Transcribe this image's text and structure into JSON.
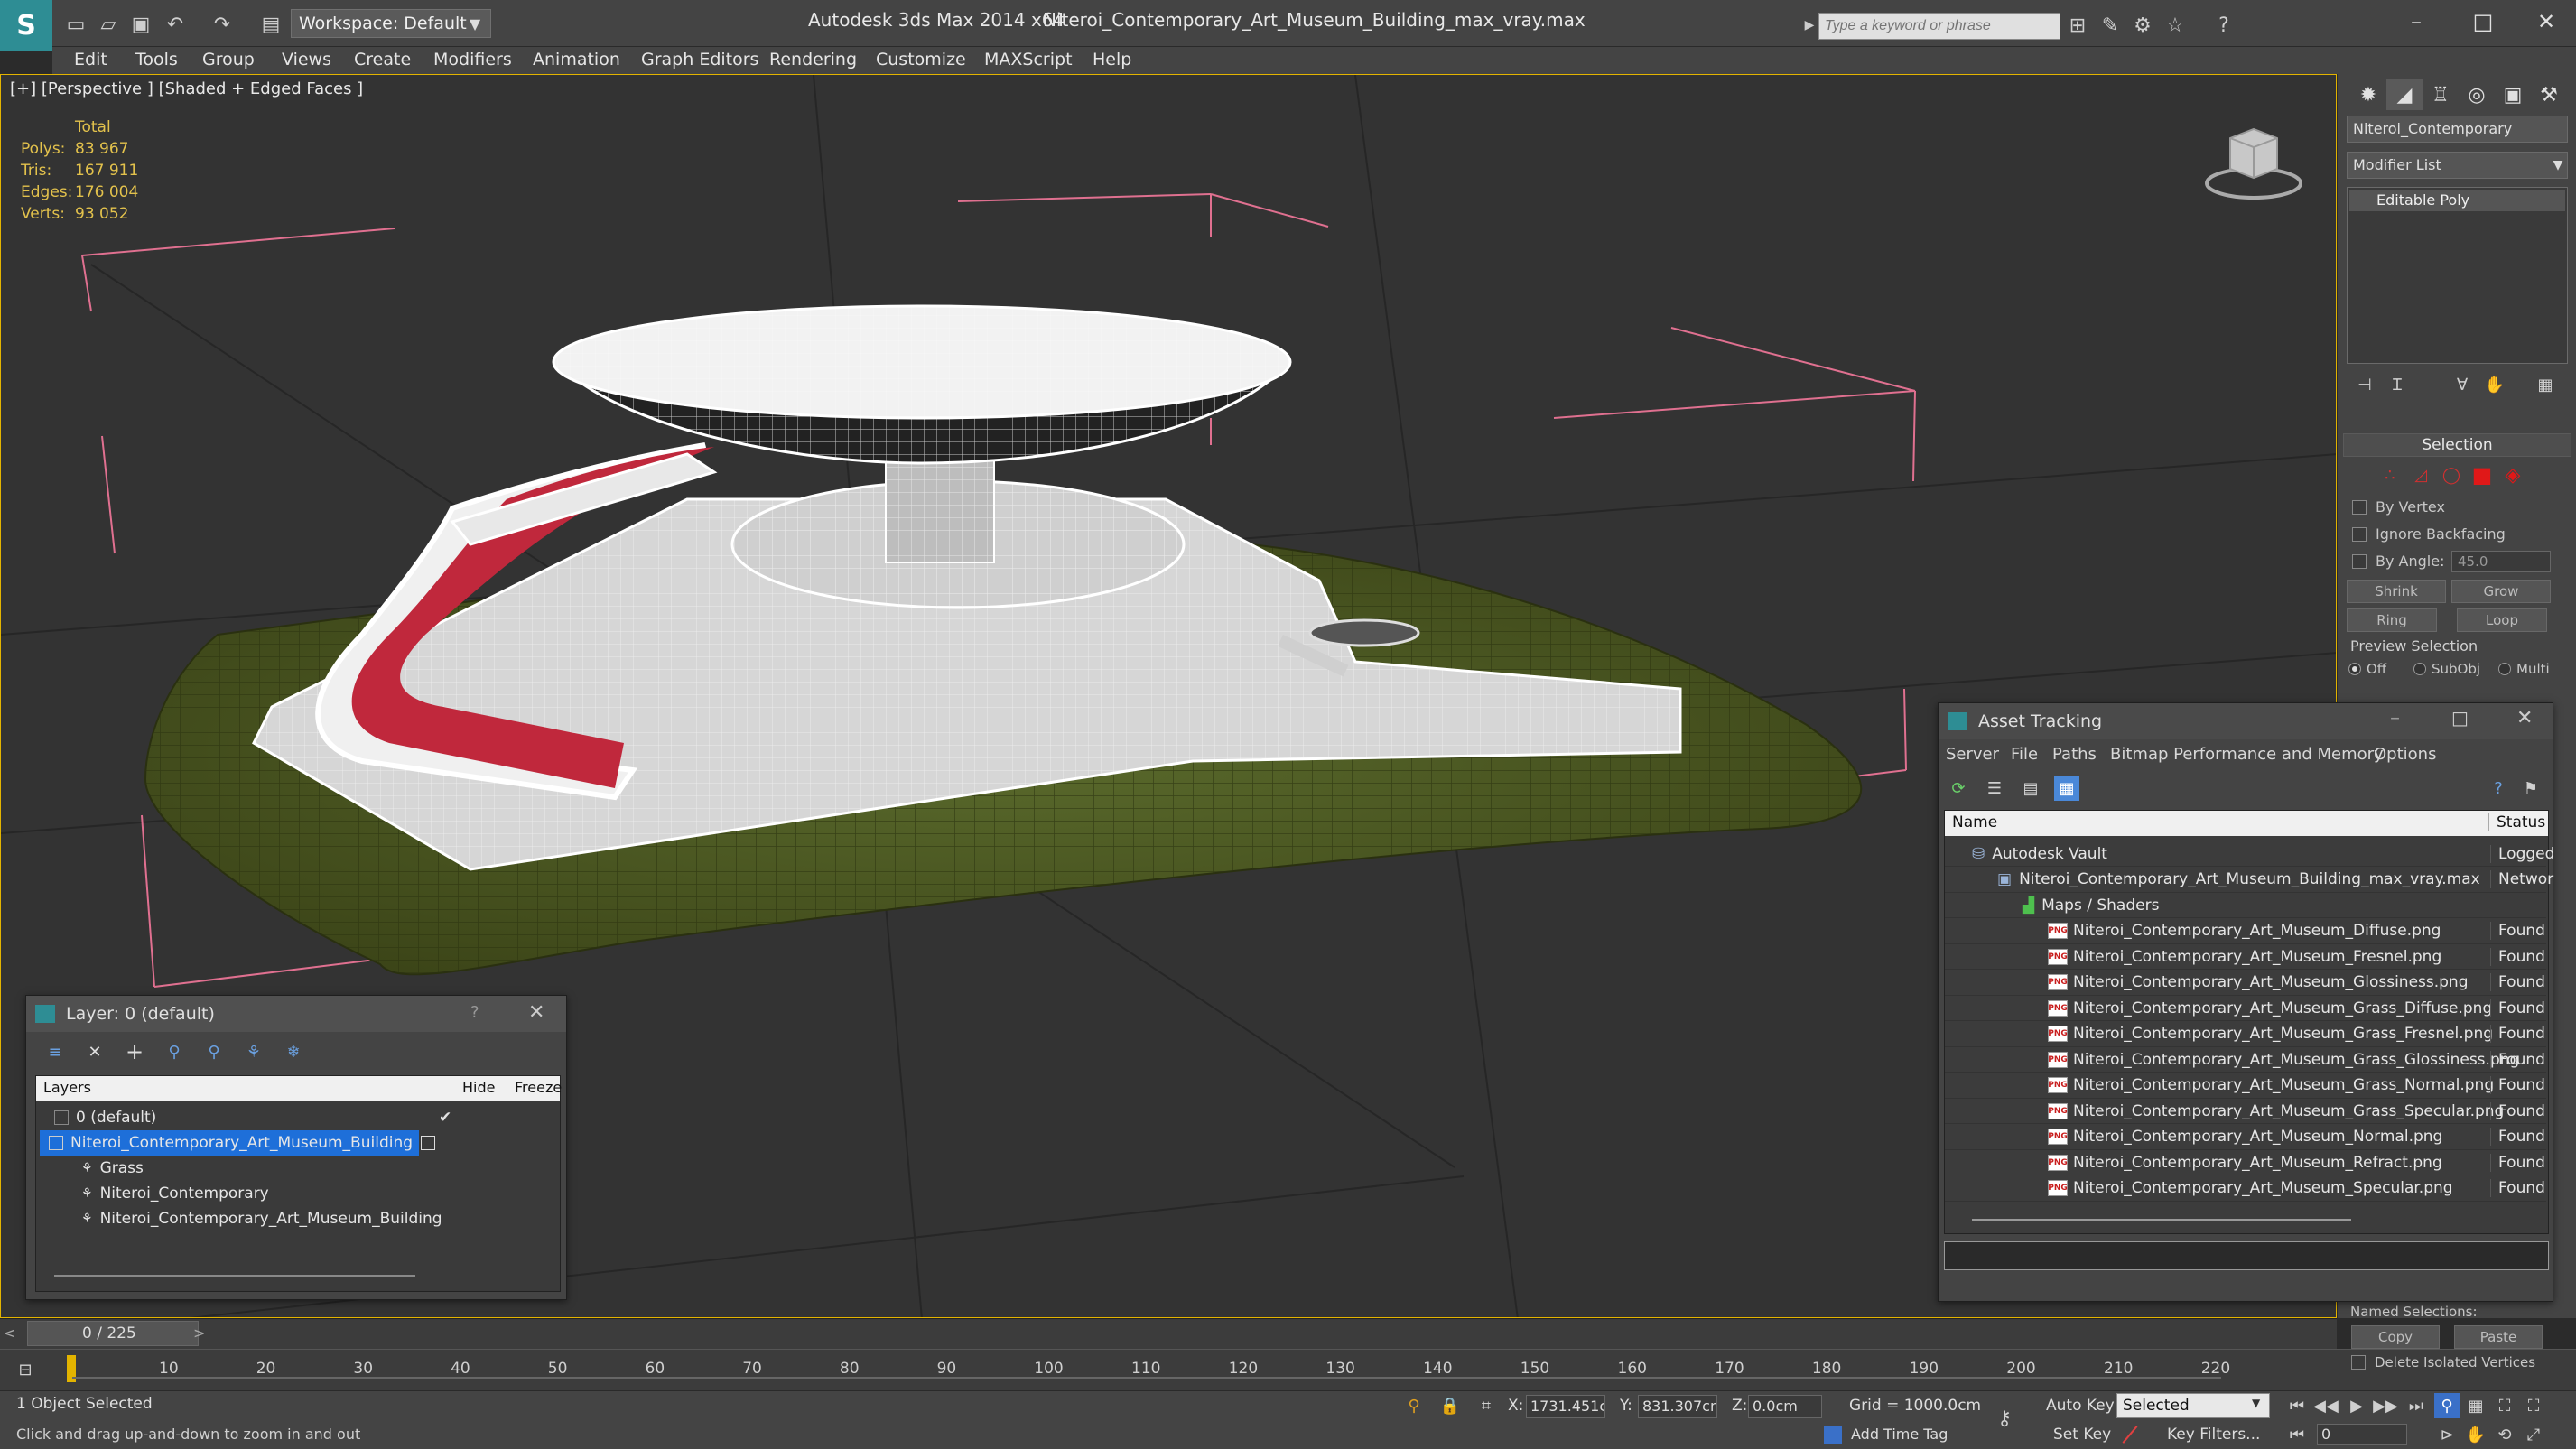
{
  "titlebar": {
    "workspace": "Workspace: Default",
    "app_title": "Autodesk 3ds Max  2014 x64",
    "file_title": "Niteroi_Contemporary_Art_Museum_Building_max_vray.max",
    "search_placeholder": "Type a keyword or phrase"
  },
  "menu": [
    "Edit",
    "Tools",
    "Group",
    "Views",
    "Create",
    "Modifiers",
    "Animation",
    "Graph Editors",
    "Rendering",
    "Customize",
    "MAXScript",
    "Help"
  ],
  "viewport": {
    "label": "[+] [Perspective ] [Shaded + Edged Faces ]",
    "stats": {
      "header": "Total",
      "rows": [
        {
          "label": "Polys:",
          "value": "83 967"
        },
        {
          "label": "Tris:",
          "value": "167 911"
        },
        {
          "label": "Edges:",
          "value": "176 004"
        },
        {
          "label": "Verts:",
          "value": "93 052"
        }
      ]
    }
  },
  "command_panel": {
    "object_name": "Niteroi_Contemporary",
    "modifier_list": "Modifier List",
    "modifier_item": "Editable Poly",
    "selection_title": "Selection",
    "by_vertex": "By Vertex",
    "ignore_backfacing": "Ignore Backfacing",
    "by_angle": "By Angle:",
    "angle_value": "45.0",
    "shrink": "Shrink",
    "grow": "Grow",
    "ring": "Ring",
    "loop": "Loop",
    "preview_selection": "Preview Selection",
    "preview_off": "Off",
    "preview_subobj": "SubObj",
    "preview_multi": "Multi",
    "named_selections": "Named Selections:",
    "copy": "Copy",
    "paste": "Paste",
    "delete_isolated": "Delete Isolated Vertices"
  },
  "layer_window": {
    "title": "Layer: 0 (default)",
    "help": "?",
    "col_layers": "Layers",
    "col_hide": "Hide",
    "col_freeze": "Freeze",
    "rows": [
      {
        "name": "0 (default)",
        "level": 0
      },
      {
        "name": "Niteroi_Contemporary_Art_Museum_Building",
        "level": 0
      },
      {
        "name": "Grass",
        "level": 1
      },
      {
        "name": "Niteroi_Contemporary",
        "level": 1
      },
      {
        "name": "Niteroi_Contemporary_Art_Museum_Building",
        "level": 1
      }
    ]
  },
  "asset_window": {
    "title": "Asset Tracking",
    "menu": [
      "Server",
      "File",
      "Paths",
      "Bitmap Performance and Memory",
      "Options"
    ],
    "col_name": "Name",
    "col_status": "Status",
    "rows": [
      {
        "name": "Autodesk Vault",
        "status": "Logged",
        "level": 0,
        "icon": "vault"
      },
      {
        "name": "Niteroi_Contemporary_Art_Museum_Building_max_vray.max",
        "status": "Networ",
        "level": 1,
        "icon": "max"
      },
      {
        "name": "Maps / Shaders",
        "status": "",
        "level": 2,
        "icon": "maps"
      },
      {
        "name": "Niteroi_Contemporary_Art_Museum_Diffuse.png",
        "status": "Found",
        "level": 3,
        "icon": "png"
      },
      {
        "name": "Niteroi_Contemporary_Art_Museum_Fresnel.png",
        "status": "Found",
        "level": 3,
        "icon": "png"
      },
      {
        "name": "Niteroi_Contemporary_Art_Museum_Glossiness.png",
        "status": "Found",
        "level": 3,
        "icon": "png"
      },
      {
        "name": "Niteroi_Contemporary_Art_Museum_Grass_Diffuse.png",
        "status": "Found",
        "level": 3,
        "icon": "png"
      },
      {
        "name": "Niteroi_Contemporary_Art_Museum_Grass_Fresnel.png",
        "status": "Found",
        "level": 3,
        "icon": "png"
      },
      {
        "name": "Niteroi_Contemporary_Art_Museum_Grass_Glossiness.png",
        "status": "Found",
        "level": 3,
        "icon": "png"
      },
      {
        "name": "Niteroi_Contemporary_Art_Museum_Grass_Normal.png",
        "status": "Found",
        "level": 3,
        "icon": "png"
      },
      {
        "name": "Niteroi_Contemporary_Art_Museum_Grass_Specular.png",
        "status": "Found",
        "level": 3,
        "icon": "png"
      },
      {
        "name": "Niteroi_Contemporary_Art_Museum_Normal.png",
        "status": "Found",
        "level": 3,
        "icon": "png"
      },
      {
        "name": "Niteroi_Contemporary_Art_Museum_Refract.png",
        "status": "Found",
        "level": 3,
        "icon": "png"
      },
      {
        "name": "Niteroi_Contemporary_Art_Museum_Specular.png",
        "status": "Found",
        "level": 3,
        "icon": "png"
      }
    ]
  },
  "timeline": {
    "frame": "0 / 225",
    "ticks": [
      "10",
      "20",
      "30",
      "40",
      "50",
      "60",
      "70",
      "80",
      "90",
      "100",
      "110",
      "120",
      "130",
      "140",
      "150",
      "160",
      "170",
      "180",
      "190",
      "200",
      "210",
      "220"
    ]
  },
  "status": {
    "selected": "1 Object Selected",
    "hint": "Click and drag up-and-down to zoom in and out",
    "x_label": "X:",
    "x_value": "1731.451c",
    "y_label": "Y:",
    "y_value": "831.307cm",
    "z_label": "Z:",
    "z_value": "0.0cm",
    "grid": "Grid = 1000.0cm",
    "auto_key": "Auto Key",
    "selected_dropdown": "Selected",
    "set_key": "Set Key",
    "key_filters": "Key Filters...",
    "add_time_tag": "Add Time Tag",
    "frame_value": "0"
  },
  "colors": {
    "accent": "#e3b400",
    "stats": "#e3c24c",
    "selection_blue": "#1e6fd9",
    "stair_red": "#c0283c",
    "grass": "#4e5a24"
  }
}
